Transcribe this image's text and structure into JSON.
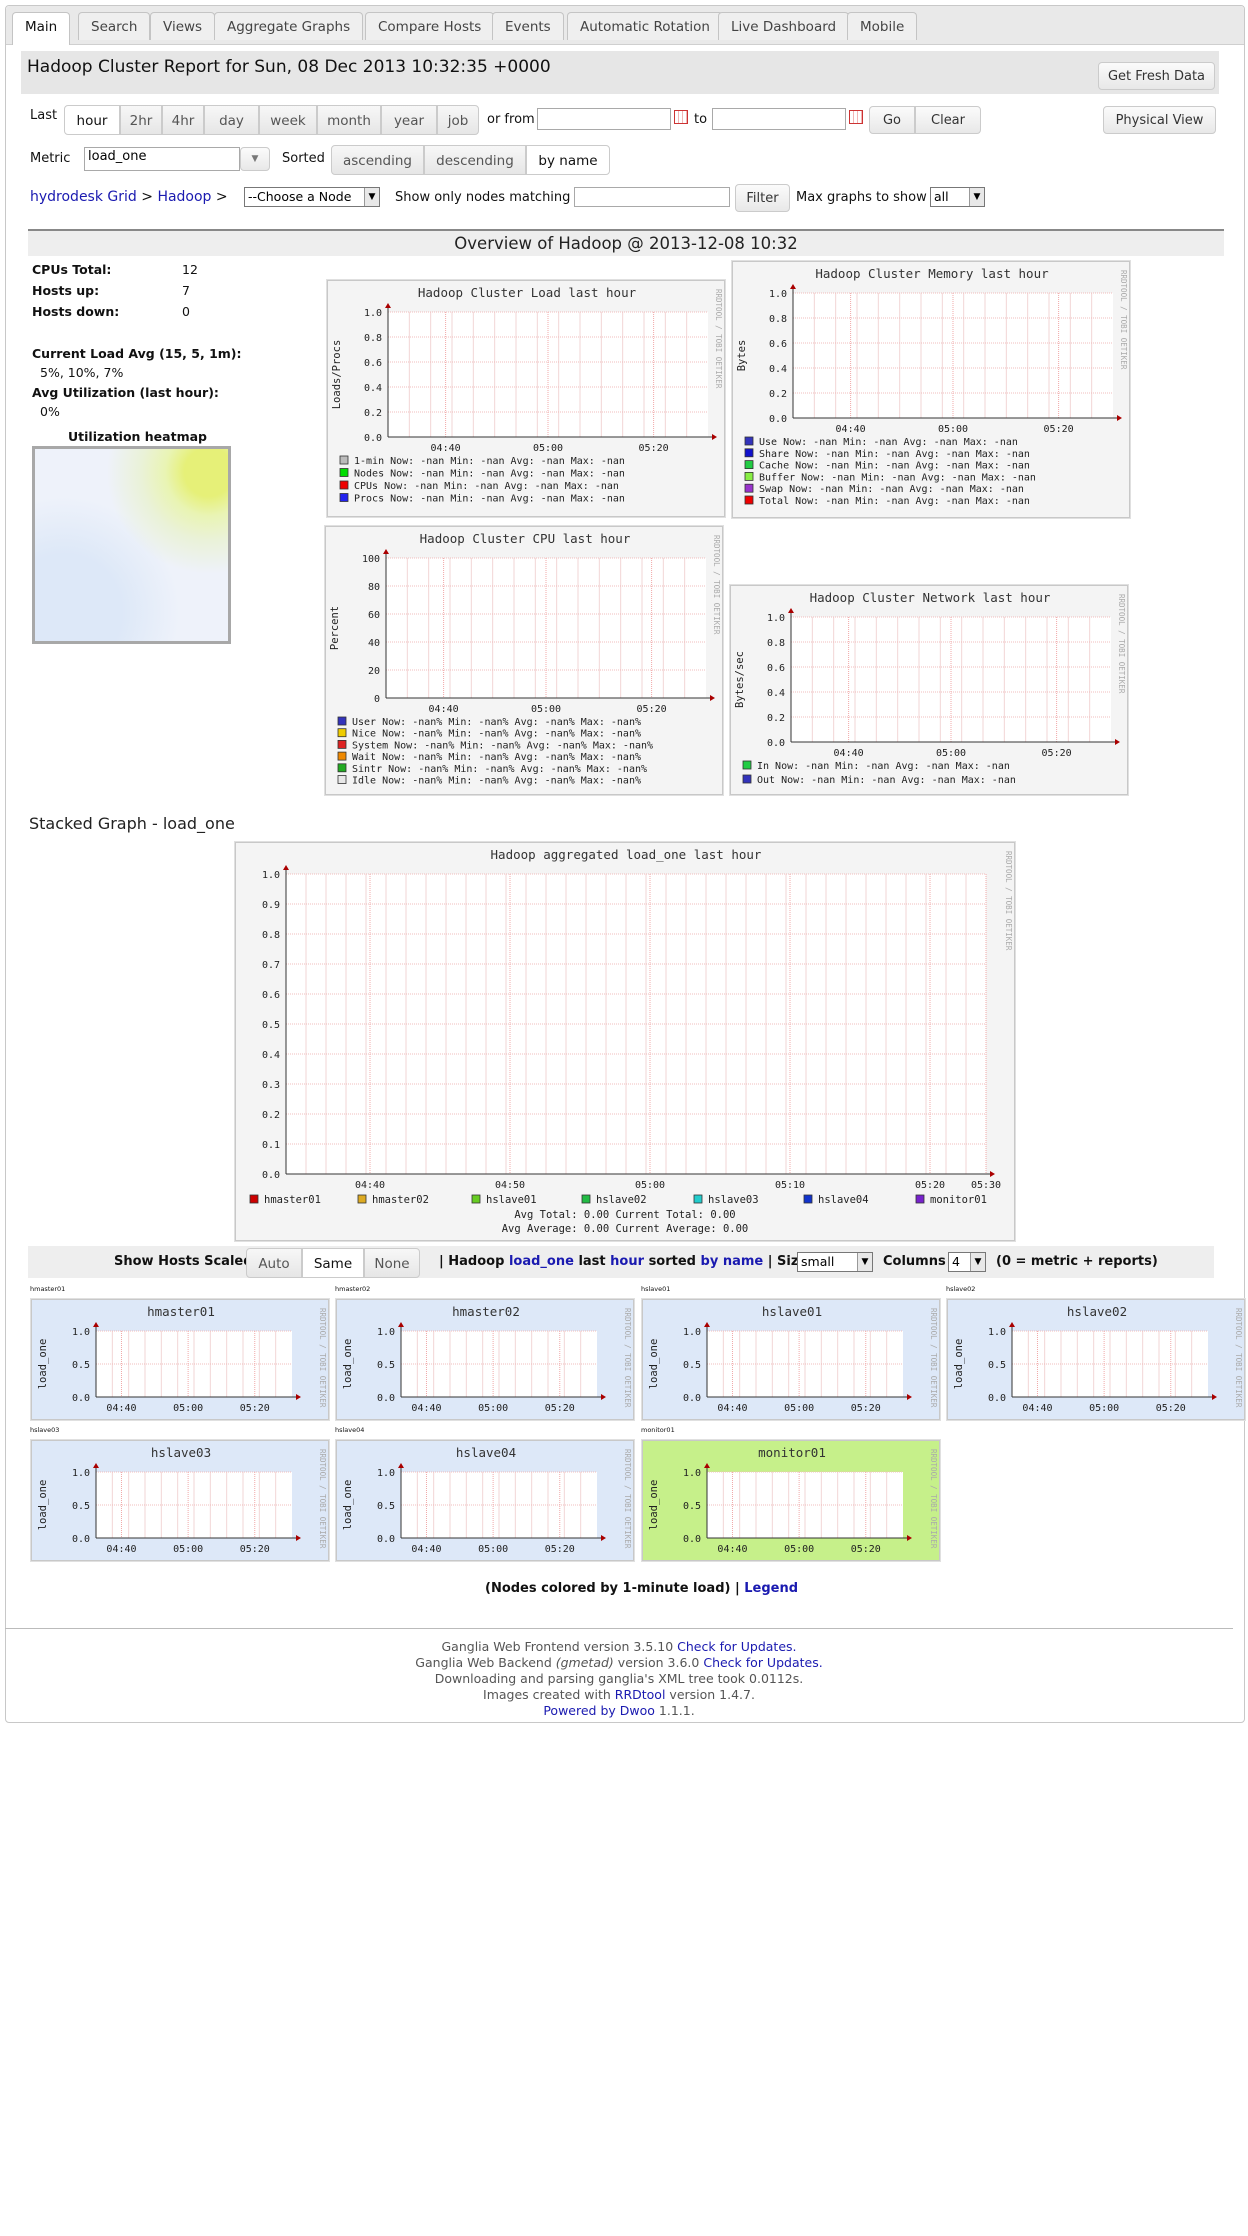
{
  "tabs": [
    "Main",
    "Search",
    "Views",
    "Aggregate Graphs",
    "Compare Hosts",
    "Events",
    "Automatic Rotation",
    "Live Dashboard",
    "Mobile"
  ],
  "header": {
    "title": "Hadoop Cluster Report for Sun, 08 Dec 2013 10:32:35 +0000",
    "fresh_button": "Get Fresh Data",
    "physical_button": "Physical View"
  },
  "range": {
    "label": "Last",
    "options": [
      "hour",
      "2hr",
      "4hr",
      "day",
      "week",
      "month",
      "year",
      "job"
    ],
    "selected": "hour",
    "or_from": "or from",
    "to": "to",
    "go": "Go",
    "clear": "Clear"
  },
  "metric": {
    "label": "Metric",
    "value": "load_one",
    "sorted_label": "Sorted",
    "sort_options": [
      "ascending",
      "descending",
      "by name"
    ],
    "sort_selected": "by name"
  },
  "nav": {
    "grid_link": "hydrodesk Grid",
    "sep1": ">",
    "cluster_link": "Hadoop",
    "sep2": ">",
    "node_select": "--Choose a Node",
    "match_label": "Show only nodes matching",
    "filter_button": "Filter",
    "max_label": "Max graphs to show",
    "max_value": "all"
  },
  "overview": {
    "title": "Overview of Hadoop @ 2013-12-08 10:32",
    "cpus_label": "CPUs Total:",
    "cpus_value": "12",
    "up_label": "Hosts up:",
    "up_value": "7",
    "down_label": "Hosts down:",
    "down_value": "0",
    "load_label": "Current Load Avg (15, 5, 1m):",
    "load_value": "5%, 10%, 7%",
    "util_label": "Avg Utilization (last hour):",
    "util_value": "0%",
    "heatmap_label": "Utilization heatmap"
  },
  "graphs": {
    "watermark": "RRDTOOL / TOBI OETIKER",
    "load": {
      "title": "Hadoop Cluster Load last hour",
      "ylabel": "Loads/Procs",
      "yticks": [
        "1.0",
        "0.8",
        "0.6",
        "0.4",
        "0.2",
        "0.0"
      ],
      "xticks": [
        "04:40",
        "05:00",
        "05:20"
      ],
      "legend": [
        {
          "name": "1-min",
          "color": "#bbbbbb",
          "text": "1-min   Now: -nan     Min: -nan     Avg: -nan     Max: -nan"
        },
        {
          "name": "Nodes",
          "color": "#00dd00",
          "text": "Nodes   Now: -nan     Min: -nan     Avg: -nan     Max: -nan"
        },
        {
          "name": "CPUs",
          "color": "#ee0000",
          "text": "CPUs    Now: -nan     Min: -nan     Avg: -nan     Max: -nan"
        },
        {
          "name": "Procs",
          "color": "#2222ee",
          "text": "Procs   Now: -nan     Min: -nan     Avg: -nan     Max: -nan"
        }
      ]
    },
    "memory": {
      "title": "Hadoop Cluster Memory last hour",
      "ylabel": "Bytes",
      "yticks": [
        "1.0",
        "0.8",
        "0.6",
        "0.4",
        "0.2",
        "0.0"
      ],
      "xticks": [
        "04:40",
        "05:00",
        "05:20"
      ],
      "legend": [
        {
          "name": "Use",
          "color": "#3333bb",
          "text": "Use     Now:   -nan    Min:   -nan    Avg:   -nan    Max:   -nan"
        },
        {
          "name": "Share",
          "color": "#1111cc",
          "text": "Share   Now:   -nan    Min:   -nan    Avg:   -nan    Max:   -nan"
        },
        {
          "name": "Cache",
          "color": "#22cc44",
          "text": "Cache   Now:   -nan    Min:   -nan    Avg:   -nan    Max:   -nan"
        },
        {
          "name": "Buffer",
          "color": "#88ee44",
          "text": "Buffer  Now:   -nan    Min:   -nan    Avg:   -nan    Max:   -nan"
        },
        {
          "name": "Swap",
          "color": "#9933cc",
          "text": "Swap    Now:   -nan    Min:   -nan    Avg:   -nan    Max:   -nan"
        },
        {
          "name": "Total",
          "color": "#ee0000",
          "text": "Total   Now:   -nan    Min:   -nan    Avg:   -nan    Max:   -nan"
        }
      ]
    },
    "cpu": {
      "title": "Hadoop Cluster CPU last hour",
      "ylabel": "Percent",
      "yticks": [
        "100",
        "80",
        "60",
        "40",
        "20",
        "0"
      ],
      "xticks": [
        "04:40",
        "05:00",
        "05:20"
      ],
      "legend": [
        {
          "name": "User",
          "color": "#3333bb",
          "text": "User   Now:  -nan%    Min:  -nan%    Avg:  -nan%    Max:  -nan%"
        },
        {
          "name": "Nice",
          "color": "#eecc00",
          "text": "Nice   Now:  -nan%    Min:  -nan%    Avg:  -nan%    Max:  -nan%"
        },
        {
          "name": "System",
          "color": "#dd2222",
          "text": "System Now:  -nan%    Min:  -nan%    Avg:  -nan%    Max:  -nan%"
        },
        {
          "name": "Wait",
          "color": "#ee8800",
          "text": "Wait   Now:  -nan%    Min:  -nan%    Avg:  -nan%    Max:  -nan%"
        },
        {
          "name": "Sintr",
          "color": "#22aa22",
          "text": "Sintr   Now:  -nan%    Min:  -nan%    Avg:  -nan%    Max:  -nan%"
        },
        {
          "name": "Idle",
          "color": "#e8e8e8",
          "text": "Idle   Now:  -nan%    Min:  -nan%    Avg:  -nan%    Max:  -nan%"
        }
      ]
    },
    "network": {
      "title": "Hadoop Cluster Network last hour",
      "ylabel": "Bytes/sec",
      "yticks": [
        "1.0",
        "0.8",
        "0.6",
        "0.4",
        "0.2",
        "0.0"
      ],
      "xticks": [
        "04:40",
        "05:00",
        "05:20"
      ],
      "legend": [
        {
          "name": "In",
          "color": "#22cc44",
          "text": "In    Now: -nan     Min: -nan     Avg: -nan     Max: -nan"
        },
        {
          "name": "Out",
          "color": "#3333bb",
          "text": "Out   Now: -nan     Min: -nan     Avg: -nan     Max: -nan"
        }
      ]
    }
  },
  "stacked": {
    "heading": "Stacked Graph - load_one",
    "title": "Hadoop aggregated load_one last hour",
    "yticks": [
      "1.0",
      "0.9",
      "0.8",
      "0.7",
      "0.6",
      "0.5",
      "0.4",
      "0.3",
      "0.2",
      "0.1",
      "0.0"
    ],
    "xticks": [
      "04:40",
      "04:50",
      "05:00",
      "05:10",
      "05:20",
      "05:30"
    ],
    "legend": [
      {
        "name": "hmaster01",
        "color": "#cc0000"
      },
      {
        "name": "hmaster02",
        "color": "#ddaa22"
      },
      {
        "name": "hslave01",
        "color": "#66cc22"
      },
      {
        "name": "hslave02",
        "color": "#22bb44"
      },
      {
        "name": "hslave03",
        "color": "#22cccc"
      },
      {
        "name": "hslave04",
        "color": "#1133cc"
      },
      {
        "name": "monitor01",
        "color": "#7722cc"
      }
    ],
    "totals_line1": "Avg Total:   0.00   Current Total:   0.00",
    "totals_line2": "Avg Average:   0.00   Current Average:   0.00"
  },
  "hosts_bar": {
    "scaled_label": "Show Hosts Scaled:",
    "scale_options": [
      "Auto",
      "Same",
      "None"
    ],
    "scale_selected": "Same",
    "sep": "|",
    "cluster": "Hadoop",
    "metric": "load_one",
    "last": "last",
    "range": "hour",
    "sorted": "sorted",
    "sortby": "by name",
    "size_label": "| Size",
    "size_value": "small",
    "columns_label": "Columns",
    "columns_value": "4",
    "columns_note": "(0 = metric + reports)"
  },
  "hosts": [
    {
      "name": "hmaster01",
      "color": "#dde8f8"
    },
    {
      "name": "hmaster02",
      "color": "#dde8f8"
    },
    {
      "name": "hslave01",
      "color": "#dde8f8"
    },
    {
      "name": "hslave02",
      "color": "#dde8f8"
    },
    {
      "name": "hslave03",
      "color": "#dde8f8"
    },
    {
      "name": "hslave04",
      "color": "#dde8f8"
    },
    {
      "name": "monitor01",
      "color": "#c6f08a"
    }
  ],
  "host_graph": {
    "ylabel": "load_one",
    "yticks": [
      "1.0",
      "0.5",
      "0.0"
    ],
    "xticks": [
      "04:40",
      "05:00",
      "05:20"
    ]
  },
  "nodes_note": {
    "text": "(Nodes colored by 1-minute load)",
    "sep": "|",
    "legend_link": "Legend"
  },
  "footer": {
    "frontend_text": "Ganglia Web Frontend version 3.5.10",
    "frontend_link": "Check for Updates.",
    "backend_text1": "Ganglia Web Backend",
    "backend_italic": "(gmetad)",
    "backend_text2": "version 3.6.0",
    "backend_link": "Check for Updates.",
    "parse_text": "Downloading and parsing ganglia's XML tree took 0.0112s.",
    "images_text1": "Images created with",
    "images_link": "RRDtool",
    "images_text2": "version 1.4.7.",
    "powered_link": "Powered by Dwoo",
    "powered_version": "1.1.1."
  }
}
